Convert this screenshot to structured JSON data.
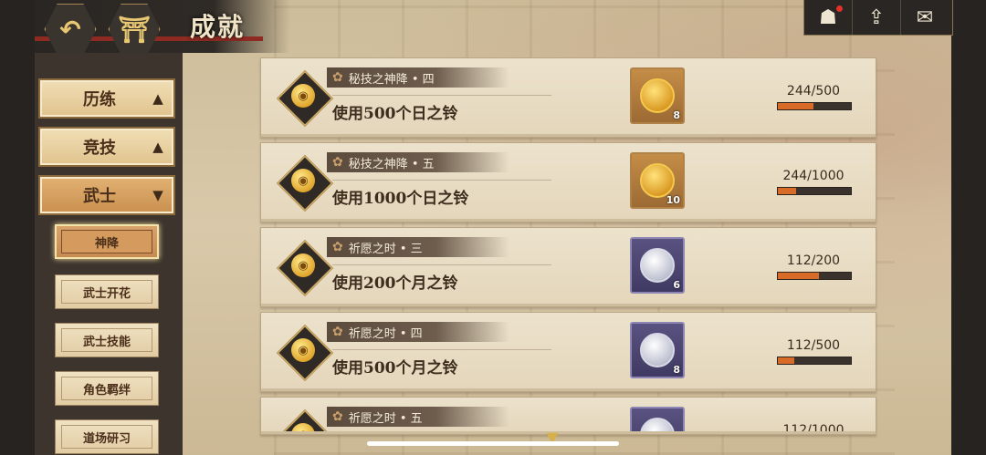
{
  "header": {
    "title": "成就",
    "back_icon": "back-arrow-icon",
    "home_icon": "torii-gate-icon"
  },
  "topright": {
    "buttons": [
      {
        "icon": "character-icon",
        "badge": true
      },
      {
        "icon": "house-up-icon",
        "badge": false
      },
      {
        "icon": "mail-icon",
        "badge": false
      }
    ]
  },
  "sidebar": {
    "categories": [
      {
        "label": "历练",
        "arrow": "▲",
        "active": false
      },
      {
        "label": "竞技",
        "arrow": "▲",
        "active": false
      },
      {
        "label": "武士",
        "arrow": "▼",
        "active": true
      }
    ],
    "subitems": [
      {
        "label": "神降",
        "active": true
      },
      {
        "label": "武士开花",
        "active": false
      },
      {
        "label": "武士技能",
        "active": false
      },
      {
        "label": "角色羁绊",
        "active": false
      },
      {
        "label": "道场研习",
        "active": false
      }
    ]
  },
  "achievements": [
    {
      "name": "秘技之神降 • 四",
      "desc": "使用500个日之铃",
      "reward_type": "gold",
      "reward_count": "8",
      "progress_text": "244/500",
      "progress": 0.488
    },
    {
      "name": "秘技之神降 • 五",
      "desc": "使用1000个日之铃",
      "reward_type": "gold",
      "reward_count": "10",
      "progress_text": "244/1000",
      "progress": 0.244
    },
    {
      "name": "祈愿之时 • 三",
      "desc": "使用200个月之铃",
      "reward_type": "purple",
      "reward_count": "6",
      "progress_text": "112/200",
      "progress": 0.56
    },
    {
      "name": "祈愿之时 • 四",
      "desc": "使用500个月之铃",
      "reward_type": "purple",
      "reward_count": "8",
      "progress_text": "112/500",
      "progress": 0.224
    },
    {
      "name": "祈愿之时 • 五",
      "desc": "",
      "reward_type": "purple",
      "reward_count": "",
      "progress_text": "112/1000",
      "progress": 0.112
    }
  ],
  "colors": {
    "progress_fill": "#d96b28",
    "title_accent": "#8e2a22"
  }
}
